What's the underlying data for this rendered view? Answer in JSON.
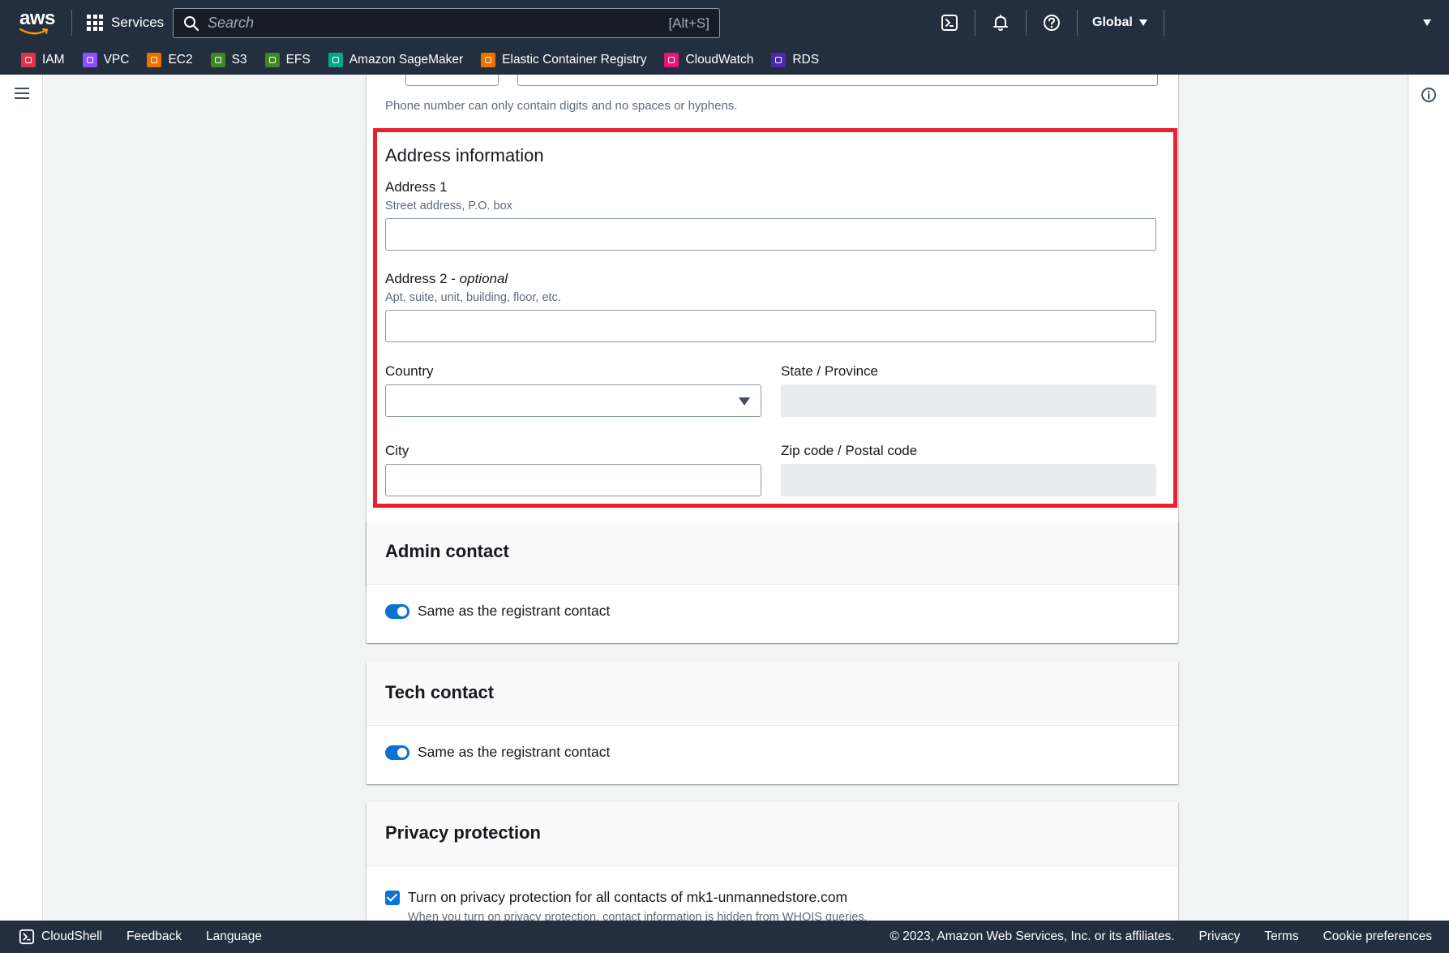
{
  "topnav": {
    "logo_text": "aws",
    "services_label": "Services",
    "search_placeholder": "Search",
    "search_shortcut": "[Alt+S]",
    "region_label": "Global"
  },
  "favorites": [
    {
      "label": "IAM",
      "color": "#dd344c",
      "icon": "iam-icon"
    },
    {
      "label": "VPC",
      "color": "#8c4fff",
      "icon": "vpc-icon"
    },
    {
      "label": "EC2",
      "color": "#ed7100",
      "icon": "ec2-icon"
    },
    {
      "label": "S3",
      "color": "#3f8624",
      "icon": "s3-icon"
    },
    {
      "label": "EFS",
      "color": "#3f8624",
      "icon": "efs-icon"
    },
    {
      "label": "Amazon SageMaker",
      "color": "#01a88d",
      "icon": "sagemaker-icon"
    },
    {
      "label": "Elastic Container Registry",
      "color": "#ed7100",
      "icon": "ecr-icon"
    },
    {
      "label": "CloudWatch",
      "color": "#e7157b",
      "icon": "cloudwatch-icon"
    },
    {
      "label": "RDS",
      "color": "#4d27aa",
      "icon": "rds-icon"
    }
  ],
  "registrant": {
    "phone_help": "Phone number can only contain digits and no spaces or hyphens.",
    "address_section_title": "Address information",
    "address1": {
      "label": "Address 1",
      "description": "Street address, P.O. box",
      "value": ""
    },
    "address2": {
      "label": "Address 2 - ",
      "label_optional": "optional",
      "description": "Apt, suite, unit, building, floor, etc.",
      "value": ""
    },
    "country": {
      "label": "Country",
      "value": ""
    },
    "state": {
      "label": "State / Province",
      "value": ""
    },
    "city": {
      "label": "City",
      "value": ""
    },
    "zip": {
      "label": "Zip code / Postal code",
      "value": ""
    }
  },
  "admin_contact": {
    "title": "Admin contact",
    "toggle_label": "Same as the registrant contact",
    "toggle_on": true
  },
  "tech_contact": {
    "title": "Tech contact",
    "toggle_label": "Same as the registrant contact",
    "toggle_on": true
  },
  "privacy": {
    "title": "Privacy protection",
    "checkbox_label": "Turn on privacy protection for all contacts of mk1-unmannedstore.com",
    "checked": true,
    "description": "When you turn on privacy protection, contact information is hidden from WHOIS queries."
  },
  "footer": {
    "cloudshell": "CloudShell",
    "feedback": "Feedback",
    "language": "Language",
    "copyright": "© 2023, Amazon Web Services, Inc. or its affiliates.",
    "privacy": "Privacy",
    "terms": "Terms",
    "cookie": "Cookie preferences"
  },
  "colors": {
    "nav_bg": "#232f3e",
    "highlight": "#e8202f",
    "toggle_on": "#0972d3"
  }
}
